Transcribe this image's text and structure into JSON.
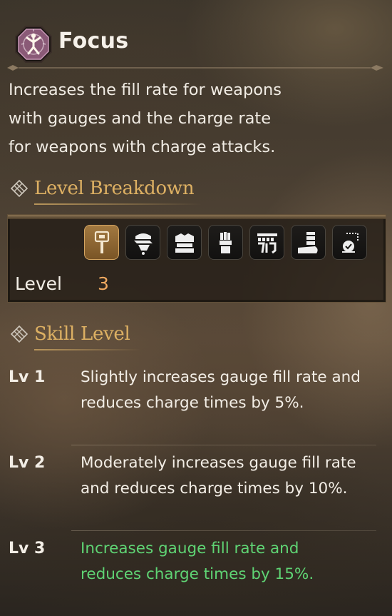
{
  "skill": {
    "name": "Focus",
    "icon": "focus-skill-emblem",
    "description_lines": [
      "Increases the fill rate for weapons",
      "with gauges and the charge rate",
      "for weapons with charge attacks."
    ]
  },
  "level_breakdown": {
    "header": "Level Breakdown",
    "equipment_slots": [
      {
        "icon": "weapon-hammer-icon",
        "active": true
      },
      {
        "icon": "helm-icon",
        "active": false
      },
      {
        "icon": "chest-armor-icon",
        "active": false
      },
      {
        "icon": "arm-armor-icon",
        "active": false
      },
      {
        "icon": "waist-armor-icon",
        "active": false
      },
      {
        "icon": "leg-armor-icon",
        "active": false
      },
      {
        "icon": "talisman-icon",
        "active": false
      }
    ],
    "level_label": "Level",
    "level_value": "3"
  },
  "skill_level": {
    "header": "Skill Level",
    "levels": [
      {
        "label": "Lv 1",
        "lines": [
          "Slightly increases gauge fill rate and",
          "reduces charge times by 5%."
        ],
        "current": false
      },
      {
        "label": "Lv 2",
        "lines": [
          "Moderately increases gauge fill rate",
          "and reduces charge times by 10%."
        ],
        "current": false
      },
      {
        "label": "Lv 3",
        "lines": [
          "Increases gauge fill rate and",
          "reduces charge times by 15%."
        ],
        "current": true
      }
    ]
  },
  "colors": {
    "section_header": "#ddb063",
    "level_value": "#f0a960",
    "current_level_text": "#5fd474",
    "emblem": "#8a5a77"
  }
}
